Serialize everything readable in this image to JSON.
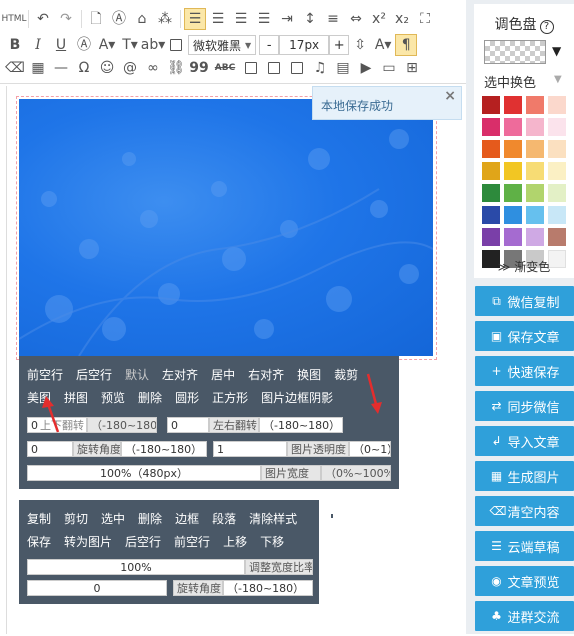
{
  "toolbar": {
    "html_label": "HTML",
    "font_family": "微软雅黑",
    "font_size": "17px",
    "minus": "-",
    "plus": "+",
    "quote_glyph": "99",
    "abc_label": "ABC"
  },
  "toast": {
    "text": "本地保存成功",
    "close": "×"
  },
  "image_panel": {
    "row1": [
      "前空行",
      "后空行",
      "默认",
      "左对齐",
      "居中",
      "右对齐",
      "换图",
      "裁剪"
    ],
    "row2": [
      "美图",
      "拼图",
      "预览",
      "删除",
      "圆形",
      "正方形",
      "图片边框阴影"
    ],
    "flip_v_value": "0",
    "flip_v_label": "上下翻转",
    "flip_v_range": "（-180~180）",
    "flip_h_value": "0",
    "flip_h_label": "左右翻转",
    "flip_h_range": "（-180~180）",
    "rotate_value": "0",
    "rotate_label": "旋转角度",
    "rotate_range": "（-180~180）",
    "opacity_value": "1",
    "opacity_label": "图片透明度",
    "opacity_range": "（0~1）",
    "width_value": "100%（480px）",
    "width_label": "图片宽度",
    "width_range": "（0%~100%）"
  },
  "block_panel": {
    "row1": [
      "复制",
      "剪切",
      "选中",
      "删除",
      "边框",
      "段落",
      "清除样式"
    ],
    "row2": [
      "保存",
      "转为图片",
      "后空行",
      "前空行",
      "上移",
      "下移"
    ],
    "width_value": "100%",
    "width_label": "调整宽度比率",
    "rotate_value": "0",
    "rotate_label": "旋转角度",
    "rotate_range": "（-180~180）"
  },
  "palette": {
    "title": "调色盘",
    "help": "?",
    "dropdown": "▼",
    "select_mode": "选中换色",
    "more": "渐变色",
    "colors": [
      "#b52020",
      "#e03131",
      "#f07a6a",
      "#fbd8cc",
      "#d92e6a",
      "#ee6b9b",
      "#f5b5cc",
      "#fbe3ec",
      "#e55a1c",
      "#f0892d",
      "#f5b870",
      "#fbe0c0",
      "#e0a519",
      "#f2c623",
      "#f7dc74",
      "#fbf0c4",
      "#2d8a3c",
      "#5fb146",
      "#b1d46d",
      "#e3f0c6",
      "#2a4aa8",
      "#2f8fe0",
      "#66c0ee",
      "#c8e7f7",
      "#7a3fa8",
      "#a56bd0",
      "#cfa9e4",
      "#b87b6c",
      "#222222",
      "#777777",
      "#c9c9c9",
      "#f3f3f3"
    ]
  },
  "sidebar_buttons": [
    {
      "icon": "⧉",
      "label": "微信复制"
    },
    {
      "icon": "▣",
      "label": "保存文章"
    },
    {
      "icon": "+",
      "label": "快速保存"
    },
    {
      "icon": "⇄",
      "label": "同步微信"
    },
    {
      "icon": "↲",
      "label": "导入文章"
    },
    {
      "icon": "▦",
      "label": "生成图片"
    },
    {
      "icon": "⌫",
      "label": "清空内容"
    },
    {
      "icon": "☰",
      "label": "云端草稿"
    },
    {
      "icon": "◉",
      "label": "文章预览"
    },
    {
      "icon": "♣",
      "label": "进群交流"
    }
  ]
}
